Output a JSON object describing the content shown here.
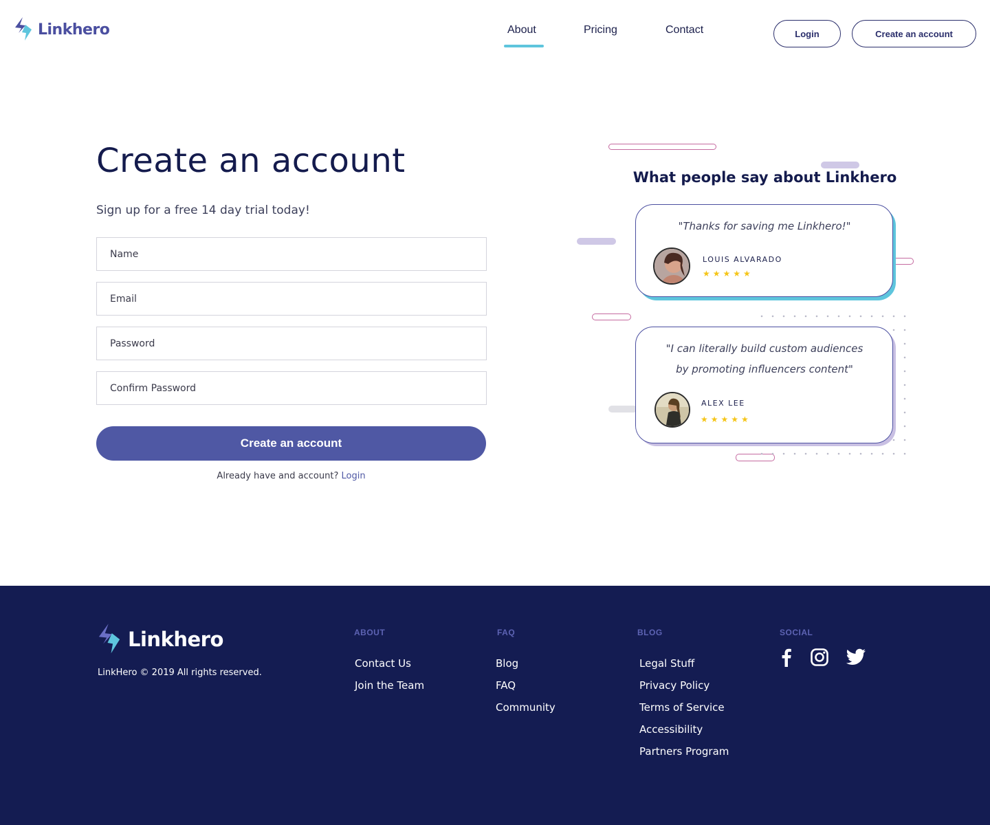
{
  "header": {
    "brand": "Linkhero",
    "nav": [
      {
        "label": "About"
      },
      {
        "label": "Pricing"
      },
      {
        "label": "Contact"
      }
    ],
    "login_label": "Login",
    "create_label": "Create an account"
  },
  "form": {
    "title": "Create an account",
    "subtitle": "Sign up for a free 14 day trial today!",
    "fields": {
      "name_placeholder": "Name",
      "email_placeholder": "Email",
      "password_placeholder": "Password",
      "confirm_placeholder": "Confirm Password"
    },
    "submit_label": "Create an account",
    "already_text": "Already have and account?",
    "login_link": "Login"
  },
  "testimonials": {
    "heading": "What people say about Linkhero",
    "items": [
      {
        "quote": "\"Thanks for saving me Linkhero!\"",
        "name": "LOUIS ALVARADO",
        "stars": "★★★★★"
      },
      {
        "quote_line1": "\"I can literally build custom audiences",
        "quote_line2": "by promoting influencers content\"",
        "name": "ALEX LEE",
        "stars": "★★★★★"
      }
    ]
  },
  "footer": {
    "brand": "Linkhero",
    "copyright": "LinkHero © 2019 All rights reserved.",
    "columns": {
      "about": {
        "heading": "ABOUT",
        "links": [
          "Contact Us",
          "Join the Team"
        ]
      },
      "faq": {
        "heading": "FAQ",
        "links": [
          "Blog",
          "FAQ",
          "Community"
        ]
      },
      "blog": {
        "heading": "BLOG",
        "links": [
          "Legal Stuff",
          "Privacy Policy",
          "Terms of Service",
          "Accessibility",
          "Partners Program"
        ]
      },
      "social": {
        "heading": "SOCIAL",
        "icons": [
          "facebook-icon",
          "instagram-icon",
          "twitter-icon"
        ]
      }
    }
  },
  "colors": {
    "brand": "#4b4fa0",
    "accent": "#5ec5dd",
    "button": "#4f58a4",
    "footer_bg": "#141c52",
    "star": "#f5c518"
  }
}
